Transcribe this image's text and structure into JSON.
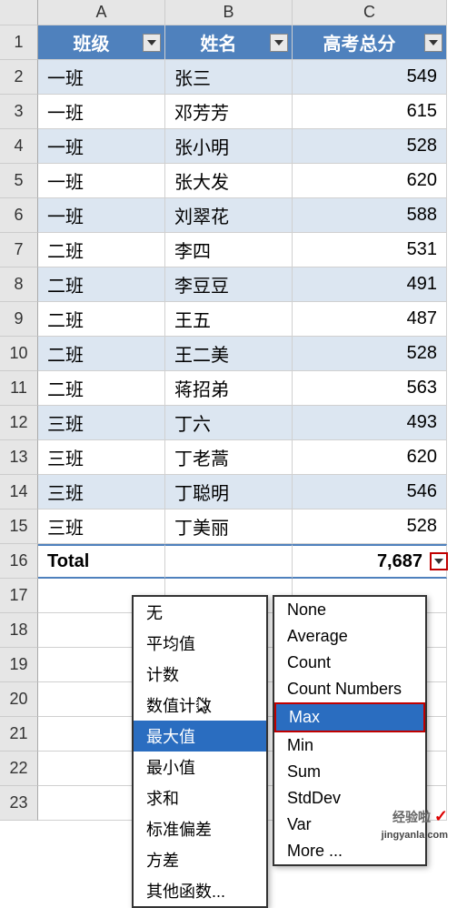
{
  "columns": {
    "A": "A",
    "B": "B",
    "C": "C"
  },
  "headers": {
    "col_a": "班级",
    "col_b": "姓名",
    "col_c": "高考总分"
  },
  "rows": [
    {
      "n": "1"
    },
    {
      "n": "2",
      "a": "一班",
      "b": "张三",
      "c": "549",
      "alt": true
    },
    {
      "n": "3",
      "a": "一班",
      "b": "邓芳芳",
      "c": "615",
      "alt": false
    },
    {
      "n": "4",
      "a": "一班",
      "b": "张小明",
      "c": "528",
      "alt": true
    },
    {
      "n": "5",
      "a": "一班",
      "b": "张大发",
      "c": "620",
      "alt": false
    },
    {
      "n": "6",
      "a": "一班",
      "b": "刘翠花",
      "c": "588",
      "alt": true
    },
    {
      "n": "7",
      "a": "二班",
      "b": "李四",
      "c": "531",
      "alt": false
    },
    {
      "n": "8",
      "a": "二班",
      "b": "李豆豆",
      "c": "491",
      "alt": true
    },
    {
      "n": "9",
      "a": "二班",
      "b": "王五",
      "c": "487",
      "alt": false
    },
    {
      "n": "10",
      "a": "二班",
      "b": "王二美",
      "c": "528",
      "alt": true
    },
    {
      "n": "11",
      "a": "二班",
      "b": "蒋招弟",
      "c": "563",
      "alt": false
    },
    {
      "n": "12",
      "a": "三班",
      "b": "丁六",
      "c": "493",
      "alt": true
    },
    {
      "n": "13",
      "a": "三班",
      "b": "丁老蒿",
      "c": "620",
      "alt": false
    },
    {
      "n": "14",
      "a": "三班",
      "b": "丁聪明",
      "c": "546",
      "alt": true
    },
    {
      "n": "15",
      "a": "三班",
      "b": "丁美丽",
      "c": "528",
      "alt": false
    }
  ],
  "total": {
    "n": "16",
    "label": "Total",
    "value": "7,687"
  },
  "empty_rows": [
    "17",
    "18",
    "19",
    "20",
    "21",
    "22",
    "23"
  ],
  "menu_cn": [
    {
      "label": "无"
    },
    {
      "label": "平均值"
    },
    {
      "label": "计数"
    },
    {
      "label": "数值计数"
    },
    {
      "label": "最大值",
      "highlighted": true
    },
    {
      "label": "最小值"
    },
    {
      "label": "求和"
    },
    {
      "label": "标准偏差"
    },
    {
      "label": "方差"
    },
    {
      "label": "其他函数..."
    }
  ],
  "menu_en": [
    {
      "label": "None"
    },
    {
      "label": "Average"
    },
    {
      "label": "Count"
    },
    {
      "label": "Count Numbers"
    },
    {
      "label": "Max",
      "highlighted": true,
      "boxed": true
    },
    {
      "label": "Min"
    },
    {
      "label": "Sum"
    },
    {
      "label": "StdDev"
    },
    {
      "label": "Var"
    },
    {
      "label": "More ..."
    }
  ],
  "watermark": {
    "text": "经验啦",
    "site": "jingyanla.com"
  }
}
